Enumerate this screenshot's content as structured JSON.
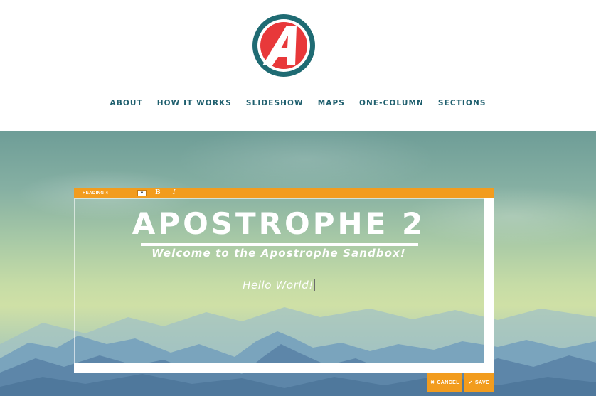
{
  "logo": {
    "name": "apostrophe-logo",
    "letter": "A",
    "ring_color": "#1f6b73",
    "fill_color": "#e8383a"
  },
  "nav": {
    "items": [
      "ABOUT",
      "HOW IT WORKS",
      "SLIDESHOW",
      "MAPS",
      "ONE-COLUMN",
      "SECTIONS"
    ]
  },
  "editor": {
    "toolbar": {
      "style_select": "HEADING 4",
      "bold_label": "B",
      "italic_label": "I"
    },
    "content": {
      "title": "APOSTROPHE 2",
      "subtitle": "Welcome to the Apostrophe Sandbox!",
      "body": "Hello World!"
    },
    "actions": {
      "cancel_label": "CANCEL",
      "save_label": "SAVE",
      "cancel_icon": "x-icon",
      "save_icon": "check-icon"
    }
  },
  "colors": {
    "nav_text": "#1f5f6e",
    "toolbar": "#f29c1e",
    "buttons": "#f29c1e"
  }
}
